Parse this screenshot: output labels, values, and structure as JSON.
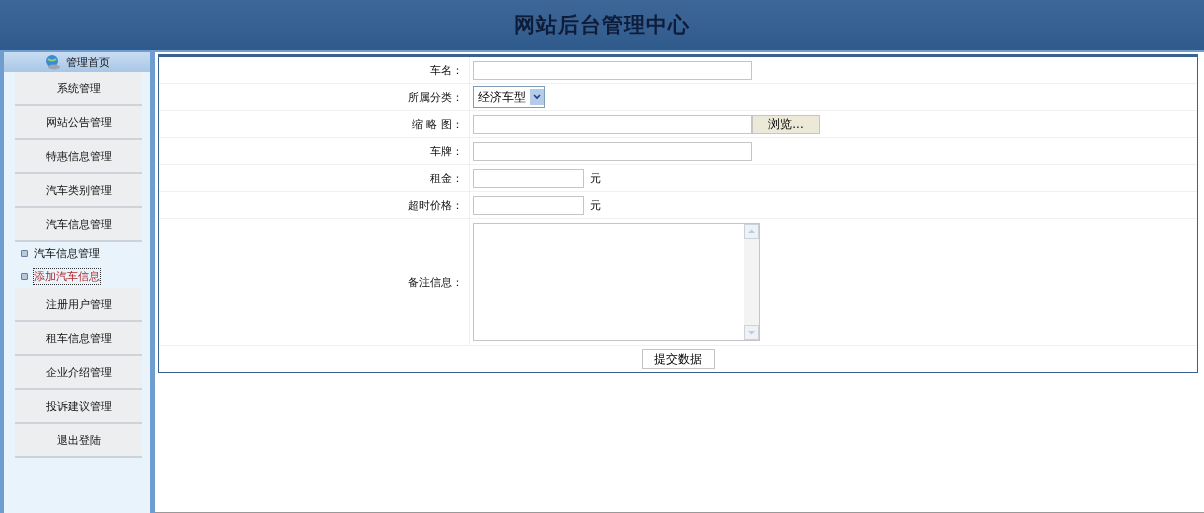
{
  "header": {
    "title": "网站后台管理中心"
  },
  "sidebar": {
    "home_label": "管理首页",
    "items": [
      {
        "label": "系统管理"
      },
      {
        "label": "网站公告管理"
      },
      {
        "label": "特惠信息管理"
      },
      {
        "label": "汽车类别管理"
      },
      {
        "label": "汽车信息管理",
        "children": [
          {
            "label": "汽车信息管理",
            "selected": false
          },
          {
            "label": "添加汽车信息",
            "selected": true
          }
        ]
      },
      {
        "label": "注册用户管理"
      },
      {
        "label": "租车信息管理"
      },
      {
        "label": "企业介绍管理"
      },
      {
        "label": "投诉建议管理"
      },
      {
        "label": "退出登陆"
      }
    ]
  },
  "form": {
    "fields": [
      {
        "kind": "text",
        "label": "车名："
      },
      {
        "kind": "select",
        "label": "所属分类：",
        "value": "经济车型"
      },
      {
        "kind": "file",
        "label": "缩 略 图：",
        "button": "浏览..."
      },
      {
        "kind": "text",
        "label": "车牌："
      },
      {
        "kind": "short",
        "label": "租金：",
        "suffix": "元"
      },
      {
        "kind": "short",
        "label": "超时价格：",
        "suffix": "元"
      },
      {
        "kind": "textarea",
        "label": "备注信息："
      }
    ],
    "submit": "提交数据"
  }
}
